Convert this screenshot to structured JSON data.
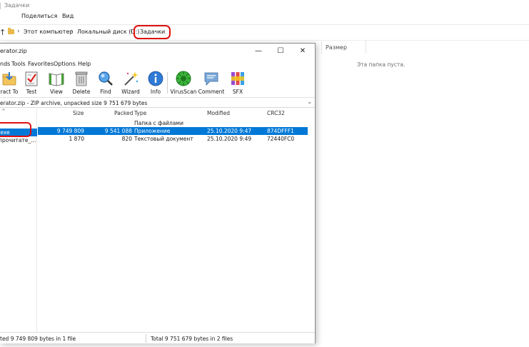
{
  "explorer": {
    "title": "Задачки",
    "ribbon_tabs": [
      "Поделиться",
      "Вид"
    ],
    "breadcrumb": [
      "Этот компьютер",
      "Локальный диск (D:)",
      "Задачки"
    ],
    "column_size": "Размер",
    "empty_message": "Эта папка пуста."
  },
  "winrar": {
    "title": "erator.zip",
    "window_buttons": {
      "minimize": "—",
      "maximize": "☐",
      "close": "✕"
    },
    "menu": [
      "nds",
      "Tools",
      "Favorites",
      "Options",
      "Help"
    ],
    "toolbar": [
      {
        "label": "ract To",
        "icon": "extract-to-icon"
      },
      {
        "label": "Test",
        "icon": "test-icon"
      },
      {
        "label": "View",
        "icon": "view-icon"
      },
      {
        "label": "Delete",
        "icon": "delete-icon"
      },
      {
        "label": "Find",
        "icon": "find-icon"
      },
      {
        "label": "Wizard",
        "icon": "wizard-icon"
      },
      {
        "label": "Info",
        "icon": "info-icon"
      },
      {
        "label": "VirusScan",
        "icon": "virusscan-icon"
      },
      {
        "label": "Comment",
        "icon": "comment-icon"
      },
      {
        "label": "SFX",
        "icon": "sfx-icon"
      }
    ],
    "path": "erator.zip - ZIP archive, unpacked size 9 751 679 bytes",
    "columns": {
      "size": "Size",
      "packed": "Packed",
      "type": "Type",
      "modified": "Modified",
      "crc": "CRC32"
    },
    "folder_row": {
      "type": "Папка с файлами"
    },
    "files": [
      {
        "name": ".exe",
        "size": "9 749 809",
        "packed": "9 541 088",
        "type": "Приложение",
        "modified": "25.10.2020 9:47",
        "crc": "874DFFF1",
        "selected": true
      },
      {
        "name": "прочитате_...",
        "size": "1 870",
        "packed": "820",
        "type": "Текстовый документ",
        "modified": "25.10.2020 9:49",
        "crc": "72440FC0",
        "selected": false
      }
    ],
    "status_left": "ted 9 749 809 bytes in 1 file",
    "status_right": "Total 9 751 679 bytes in 2 files"
  }
}
